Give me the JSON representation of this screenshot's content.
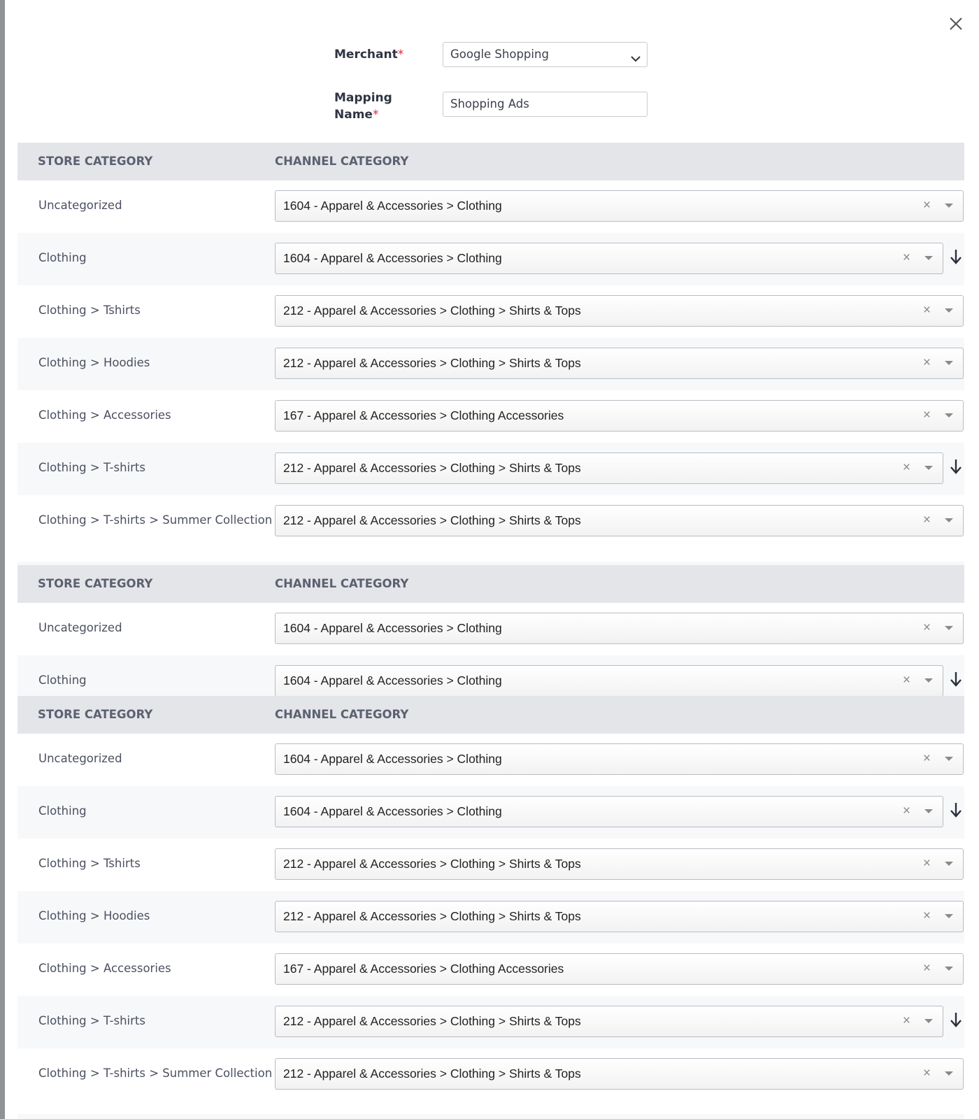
{
  "form": {
    "merchant_label": "Merchant",
    "merchant_value": "Google Shopping",
    "mapping_name_label_line1": "Mapping",
    "mapping_name_label_line2": "Name",
    "mapping_name_value": "Shopping Ads",
    "required_mark": "*"
  },
  "table": {
    "header_store": "STORE CATEGORY",
    "header_channel": "CHANNEL CATEGORY",
    "clear_symbol": "×"
  },
  "sections": [
    {
      "rows": [
        {
          "store": "Uncategorized",
          "channel": "1604 - Apparel & Accessories > Clothing",
          "reorder_arrow": false
        },
        {
          "store": "Clothing",
          "channel": "1604 - Apparel & Accessories > Clothing",
          "reorder_arrow": true
        },
        {
          "store": "Clothing > Tshirts",
          "channel": "212 - Apparel & Accessories > Clothing > Shirts & Tops",
          "reorder_arrow": false
        },
        {
          "store": "Clothing > Hoodies",
          "channel": "212 - Apparel & Accessories > Clothing > Shirts & Tops",
          "reorder_arrow": false
        },
        {
          "store": "Clothing > Accessories",
          "channel": "167 - Apparel & Accessories > Clothing Accessories",
          "reorder_arrow": false
        },
        {
          "store": "Clothing > T-shirts",
          "channel": "212 - Apparel & Accessories > Clothing > Shirts & Tops",
          "reorder_arrow": true
        },
        {
          "store": "Clothing > T-shirts > Summer Collection",
          "channel": "212 - Apparel & Accessories > Clothing > Shirts & Tops",
          "reorder_arrow": false
        }
      ]
    },
    {
      "rows": [
        {
          "store": "Uncategorized",
          "channel": "1604 - Apparel & Accessories > Clothing",
          "reorder_arrow": false
        },
        {
          "store": "Clothing",
          "channel": "1604 - Apparel & Accessories > Clothing",
          "reorder_arrow": true
        }
      ]
    },
    {
      "rows": [
        {
          "store": "Uncategorized",
          "channel": "1604 - Apparel & Accessories > Clothing",
          "reorder_arrow": false
        },
        {
          "store": "Clothing",
          "channel": "1604 - Apparel & Accessories > Clothing",
          "reorder_arrow": true
        },
        {
          "store": "Clothing > Tshirts",
          "channel": "212 - Apparel & Accessories > Clothing > Shirts & Tops",
          "reorder_arrow": false
        },
        {
          "store": "Clothing > Hoodies",
          "channel": "212 - Apparel & Accessories > Clothing > Shirts & Tops",
          "reorder_arrow": false
        },
        {
          "store": "Clothing > Accessories",
          "channel": "167 - Apparel & Accessories > Clothing Accessories",
          "reorder_arrow": false
        },
        {
          "store": "Clothing > T-shirts",
          "channel": "212 - Apparel & Accessories > Clothing > Shirts & Tops",
          "reorder_arrow": true
        },
        {
          "store": "Clothing > T-shirts > Summer Collection",
          "channel": "212 - Apparel & Accessories > Clothing > Shirts & Tops",
          "reorder_arrow": false
        }
      ]
    }
  ]
}
